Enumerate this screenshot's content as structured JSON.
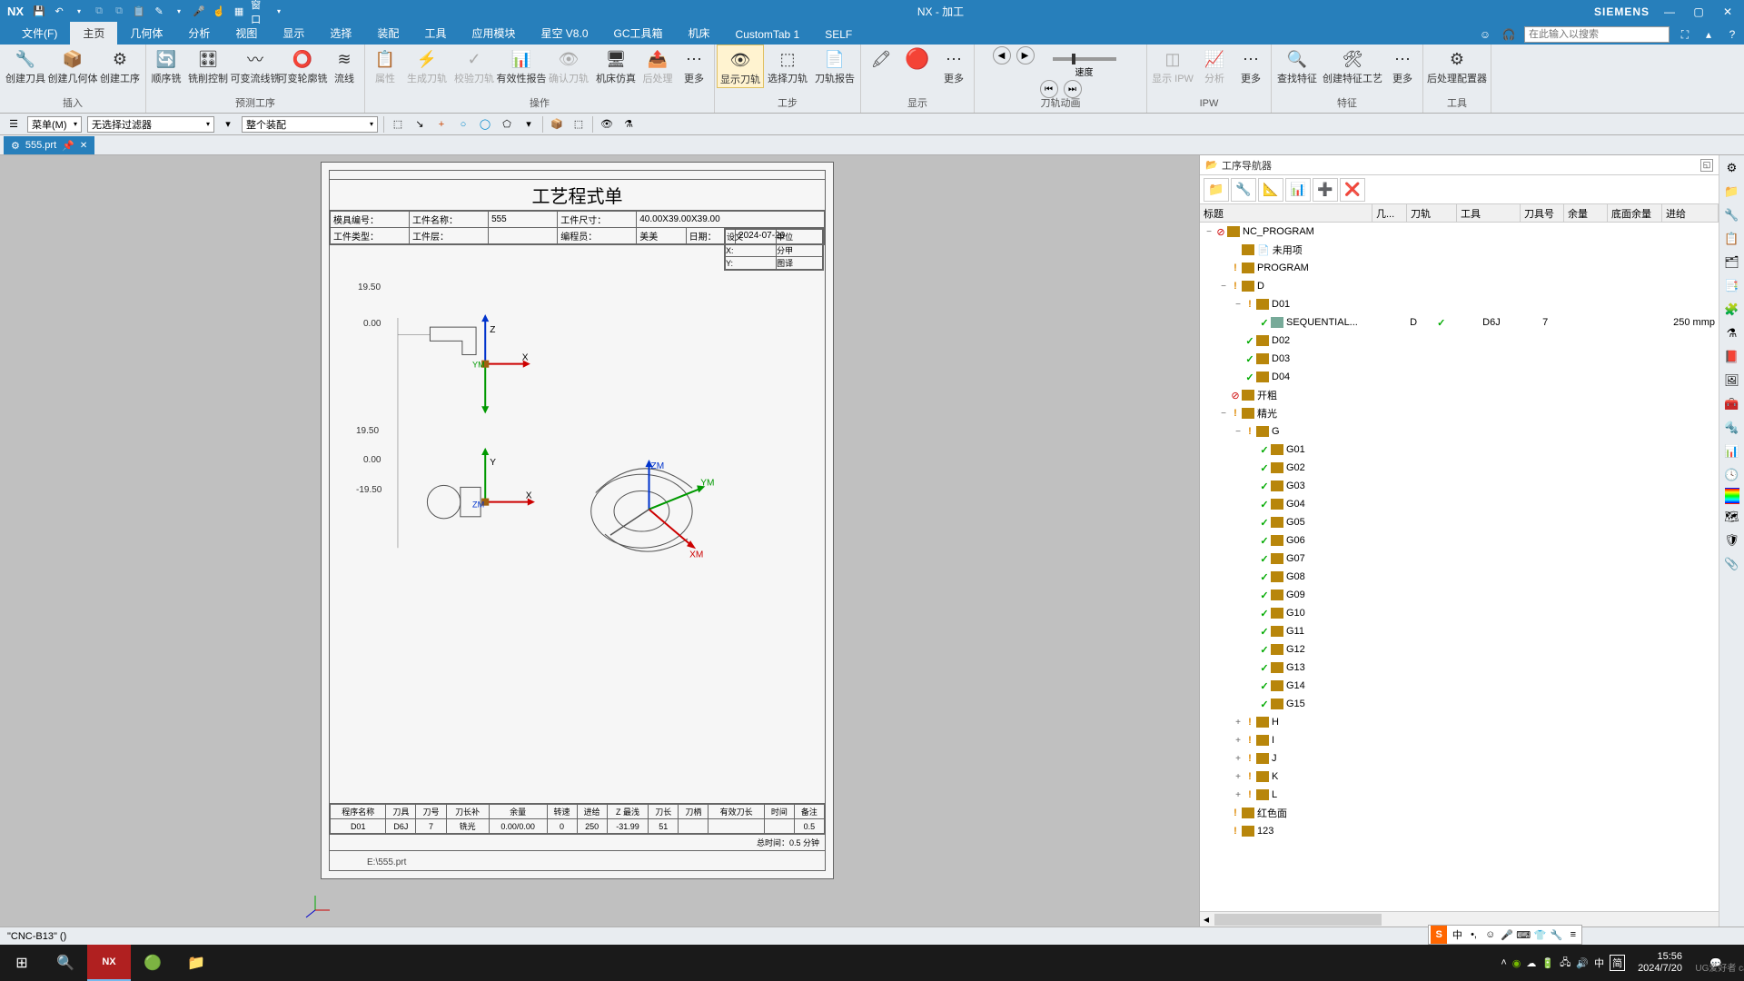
{
  "titlebar": {
    "logo": "NX",
    "title": "NX - 加工",
    "siemens": "SIEMENS",
    "window_menu": "窗口"
  },
  "menubar": {
    "tabs": [
      "文件(F)",
      "主页",
      "几何体",
      "分析",
      "视图",
      "显示",
      "选择",
      "装配",
      "工具",
      "应用模块",
      "星空 V8.0",
      "GC工具箱",
      "机床",
      "CustomTab 1",
      "SELF"
    ],
    "active": 1,
    "search_placeholder": "在此输入以搜索"
  },
  "ribbon": {
    "groups": {
      "insert": {
        "name": "插入",
        "buttons": [
          "创建刀具",
          "创建几何体",
          "创建工序"
        ]
      },
      "predict": {
        "name": "预测工序",
        "buttons": [
          "顺序铣",
          "铣削控制",
          "可变流线铣",
          "可变轮廓铣",
          "流线"
        ]
      },
      "operation": {
        "name": "操作",
        "buttons": [
          "属性",
          "生成刀轨",
          "校验刀轨",
          "有效性报告",
          "确认刀轨",
          "机床仿真",
          "后处理",
          "更多"
        ]
      },
      "workstep": {
        "name": "工步",
        "buttons": [
          "显示刀轨",
          "选择刀轨",
          "刀轨报告"
        ]
      },
      "display": {
        "name": "显示",
        "more": "更多"
      },
      "anim": {
        "name": "刀轨动画",
        "speed": "速度"
      },
      "ipw": {
        "name": "IPW",
        "buttons": [
          "显示 IPW",
          "分析",
          "更多"
        ]
      },
      "feature": {
        "name": "特征",
        "buttons": [
          "查找特征",
          "创建特征工艺",
          "更多"
        ]
      },
      "tools": {
        "name": "工具",
        "buttons": [
          "后处理配置器"
        ]
      }
    }
  },
  "selbar": {
    "menu_btn": "菜单(M)",
    "filter1": "无选择过滤器",
    "filter2": "整个装配"
  },
  "doctab": {
    "name": "555.prt"
  },
  "drawing": {
    "title": "工艺程式单",
    "row1": {
      "c1": "模具编号：",
      "c2": "工件名称：",
      "c2v": "555",
      "c3": "工件尺寸：",
      "c3v": "40.00X39.00X39.00"
    },
    "row2": {
      "c1": "工件类型：",
      "c2": "工件层：",
      "c3": "编程员：",
      "c3v": "美美",
      "c4": "日期：",
      "c4v": "2024-07-20"
    },
    "side": {
      "a": "设文",
      "b": "单位",
      "c": "分甲",
      "d": "X:",
      "e": "Y:",
      "f": "图译"
    },
    "path": "E:\\555.prt",
    "ftr_hdr": [
      "程序名称",
      "刀具",
      "刀号",
      "刀长补",
      "余量",
      "转速",
      "进给",
      "Z 最浅",
      "刀长",
      "刀柄",
      "有效刀长",
      "时间",
      "备注"
    ],
    "ftr_row": [
      "D01",
      "D6J",
      "7",
      "铣光",
      "0.00/0.00",
      "0",
      "250",
      "-31.99",
      "51",
      "",
      "",
      "",
      "0.5"
    ],
    "total_time": "总时间：0.5  分钟",
    "axis": {
      "z": "Z",
      "x": "X",
      "y": "Y",
      "zm": "ZM",
      "ym": "YM",
      "xm": "XM",
      "vals": [
        "19.50",
        "0.00",
        "-19.50"
      ]
    }
  },
  "navigator": {
    "title": "工序导航器",
    "columns": [
      "标题",
      "几...",
      "刀轨",
      "工具",
      "刀具号",
      "余量",
      "底面余量",
      "进给"
    ],
    "tree": {
      "root": "NC_PROGRAM",
      "unused": "未用项",
      "program": "PROGRAM",
      "d": "D",
      "d_children": [
        "D01",
        "D02",
        "D03",
        "D04"
      ],
      "seq": {
        "name": "SEQUENTIAL...",
        "col_geo": "D",
        "col_tool": "D6J",
        "col_num": "7",
        "col_feed": "250 mmp"
      },
      "kaicu": "开粗",
      "jingguang": "精光",
      "g": "G",
      "g_children": [
        "G01",
        "G02",
        "G03",
        "G04",
        "G05",
        "G06",
        "G07",
        "G08",
        "G09",
        "G10",
        "G11",
        "G12",
        "G13",
        "G14",
        "G15"
      ],
      "rest": [
        "H",
        "I",
        "J",
        "K",
        "L"
      ],
      "red": "红色面",
      "n123": "123"
    }
  },
  "statusbar": {
    "text": "\"CNC-B13\"  ()"
  },
  "taskbar": {
    "time": "15:56",
    "date": "2024/7/20",
    "watermark": "UG爱好者 caoxuan"
  },
  "ime": {
    "label": "中"
  }
}
